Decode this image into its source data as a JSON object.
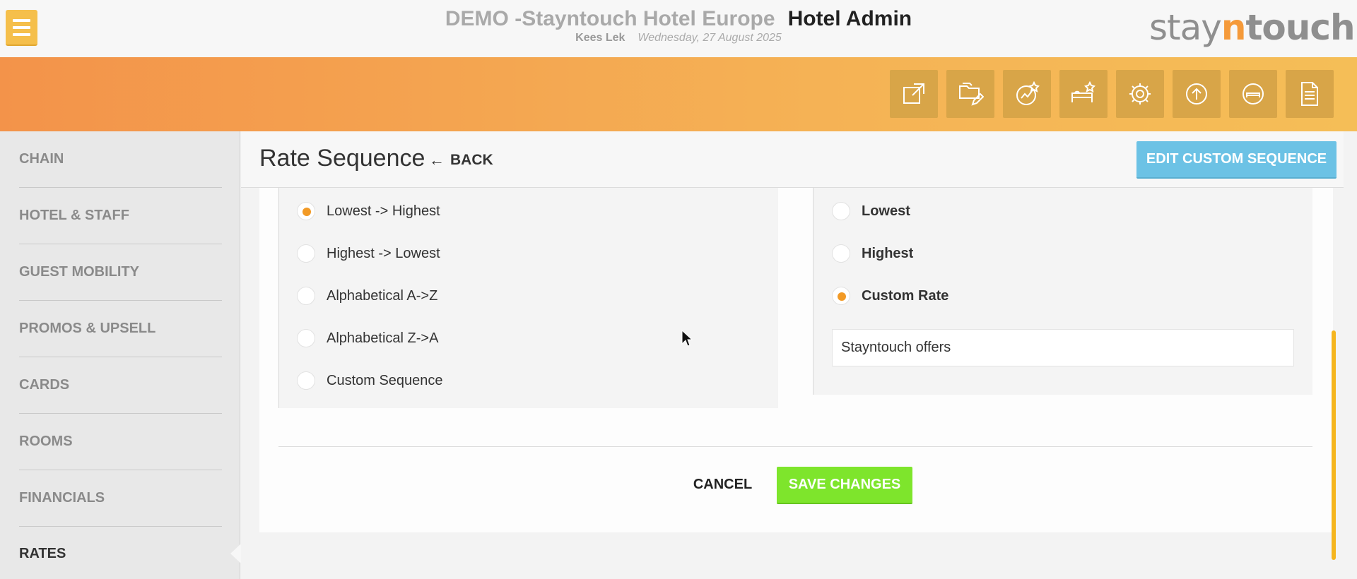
{
  "header": {
    "hotel_name": "DEMO -Stayntouch Hotel Europe",
    "admin_label": "Hotel Admin",
    "user": "Kees Lek",
    "date": "Wednesday, 27 August 2025",
    "logo_stay": "stay",
    "logo_n": "n",
    "logo_touch": "touch"
  },
  "toolbar_icons": [
    "external-link-icon",
    "folder-edit-icon",
    "chart-star-icon",
    "bed-star-icon",
    "gear-icon",
    "upload-circle-icon",
    "bed-circle-icon",
    "document-icon"
  ],
  "sidebar": {
    "items": [
      {
        "label": "CHAIN"
      },
      {
        "label": "HOTEL & STAFF"
      },
      {
        "label": "GUEST MOBILITY"
      },
      {
        "label": "PROMOS & UPSELL"
      },
      {
        "label": "CARDS"
      },
      {
        "label": "ROOMS"
      },
      {
        "label": "FINANCIALS"
      },
      {
        "label": "RATES"
      }
    ],
    "active": "RATES"
  },
  "page": {
    "title": "Rate Sequence",
    "back_label": "BACK",
    "edit_button": "EDIT CUSTOM SEQUENCE"
  },
  "sort_options": [
    {
      "label": "Lowest -> Highest",
      "checked": true
    },
    {
      "label": "Highest -> Lowest",
      "checked": false
    },
    {
      "label": "Alphabetical A->Z",
      "checked": false
    },
    {
      "label": "Alphabetical Z->A",
      "checked": false
    },
    {
      "label": "Custom Sequence",
      "checked": false
    }
  ],
  "rate_options": [
    {
      "label": "Lowest",
      "checked": false
    },
    {
      "label": "Highest",
      "checked": false
    },
    {
      "label": "Custom Rate",
      "checked": true
    }
  ],
  "custom_rate_value": "Stayntouch offers",
  "actions": {
    "cancel": "CANCEL",
    "save": "SAVE CHANGES"
  },
  "colors": {
    "accent_orange": "#f3934a",
    "accent_yellow": "#f5be57",
    "edit_blue": "#6cc2e5",
    "save_green": "#7ee52c",
    "radio_checked": "#f29a26"
  }
}
